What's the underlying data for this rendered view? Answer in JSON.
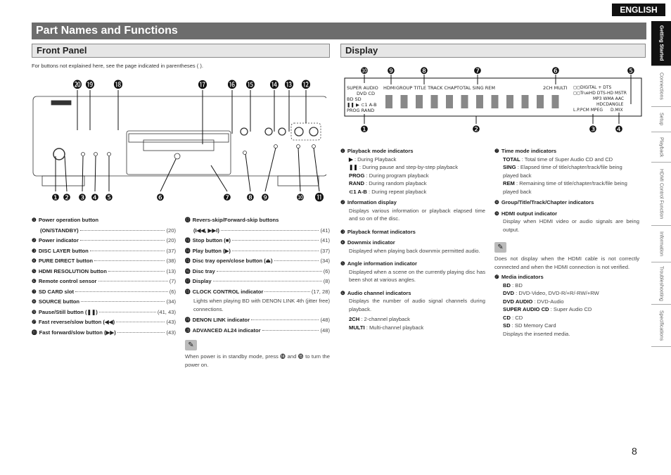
{
  "language": "ENGLISH",
  "title": "Part Names and Functions",
  "front_panel": {
    "heading": "Front Panel",
    "note": "For buttons not explained here, see the page indicated in parentheses ( ).",
    "brand": "DENON",
    "items_left": [
      {
        "num": "❶",
        "label": "Power operation button",
        "label2": "(ON/STANDBY)",
        "ref": "(20)"
      },
      {
        "num": "❷",
        "label": "Power indicator",
        "ref": "(20)"
      },
      {
        "num": "❸",
        "label": "DISC LAYER button",
        "ref": "(37)"
      },
      {
        "num": "❹",
        "label": "PURE DIRECT button",
        "ref": "(38)"
      },
      {
        "num": "❺",
        "label": "HDMI RESOLUTION button",
        "ref": "(13)"
      },
      {
        "num": "❻",
        "label": "Remote control sensor",
        "ref": "(7)"
      },
      {
        "num": "❼",
        "label": "SD CARD slot",
        "ref": "(6)"
      },
      {
        "num": "❽",
        "label": "SOURCE button",
        "ref": "(34)"
      },
      {
        "num": "❾",
        "label": "Pause/Still button (❚❚)",
        "ref": "(41, 43)"
      },
      {
        "num": "❿",
        "label": "Fast reverse/slow button (◀◀)",
        "ref": "(43)"
      },
      {
        "num": "⓫",
        "label": "Fast forward/slow button (▶▶)",
        "ref": "(43)"
      }
    ],
    "items_right": [
      {
        "num": "⓬",
        "label": "Revers-skip/Forward-skip buttons",
        "label2": "(I◀◀, ▶▶I)",
        "ref": "(41)"
      },
      {
        "num": "⓭",
        "label": "Stop button (■)",
        "ref": "(41)"
      },
      {
        "num": "⓮",
        "label": "Play button (▶)",
        "ref": "(37)"
      },
      {
        "num": "⓯",
        "label": "Disc tray open/close button (⏏)",
        "ref": "(34)"
      },
      {
        "num": "⓰",
        "label": "Disc tray",
        "ref": "(6)"
      },
      {
        "num": "⓱",
        "label": "Display",
        "ref": "(8)"
      },
      {
        "num": "⓲",
        "label": "CLOCK CONTROL indicator",
        "ref": "(17, 28)",
        "desc": "Lights when playing BD with DENON LINK 4th (jitter free) connections."
      },
      {
        "num": "⓳",
        "label": "DENON LINK indicator",
        "ref": "(48)"
      },
      {
        "num": "⓴",
        "label": "ADVANCED AL24 indicator",
        "ref": "(48)"
      }
    ],
    "memo": "When power is in standby mode, press ⓮ and ⓯ to turn the power on."
  },
  "display": {
    "heading": "Display",
    "lcd": {
      "super_audio": "SUPER AUDIO",
      "dvd_cd": "DVD   CD",
      "bd_sd": "BD SD",
      "play": "❚❚ ▶ ⊂1 A-B",
      "prog_rand": "PROG  RAND",
      "hdmi": "HDMI",
      "gttc": "GROUP  TITLE  TRACK  CHAP",
      "time": "TOTAL  SING  REM",
      "ch": "2CH  MULTI",
      "fmt1": "◻◻DIGITAL + DTS",
      "fmt2": "◻◻TrueHD DTS-HD MSTR",
      "fmt3": "MP3 WMA AAC",
      "fmt4": "HDCD",
      "angle": "ANGLE",
      "fmt5": "L.P.PCM MPEG",
      "dmix": "D.MIX"
    },
    "items_left": [
      {
        "num": "❶",
        "label": "Playback mode indicators",
        "subs": [
          {
            "k": "▶",
            "v": " : During Playback"
          },
          {
            "k": "❚❚",
            "v": " : During pause and step-by-step playback"
          },
          {
            "k": "PROG",
            "v": " : During program playback"
          },
          {
            "k": "RAND",
            "v": " : During random playback"
          },
          {
            "k": "⊂1 A-B",
            "v": " : During repeat playback"
          }
        ]
      },
      {
        "num": "❷",
        "label": "Information display",
        "desc": "Displays various information or playback elapsed time and so on of the disc."
      },
      {
        "num": "❸",
        "label": "Playback format indicators"
      },
      {
        "num": "❹",
        "label": "Downmix indicator",
        "desc": "Displayed when playing back downmix permitted audio."
      },
      {
        "num": "❺",
        "label": "Angle information indicator",
        "desc": "Displayed when a scene on the currently playing disc has been shot at various angles."
      },
      {
        "num": "❻",
        "label": "Audio channel indicators",
        "desc": "Displays the number of audio signal channels during playback.",
        "subs": [
          {
            "k": "2CH",
            "v": " : 2-channel playback"
          },
          {
            "k": "MULTI",
            "v": " : Multi-channel playback"
          }
        ]
      }
    ],
    "items_right": [
      {
        "num": "❼",
        "label": "Time mode indicators",
        "subs": [
          {
            "k": "TOTAL",
            "v": " : Total time of Super Audio CD and CD"
          },
          {
            "k": "SING",
            "v": " : Elapsed time of title/chapter/track/file being played back"
          },
          {
            "k": "REM",
            "v": " : Remaining time of title/chapter/track/file being played back"
          }
        ]
      },
      {
        "num": "❽",
        "label": "Group/Title/Track/Chapter indicators"
      },
      {
        "num": "❾",
        "label": "HDMI output indicator",
        "desc": "Display when HDMI video or audio signals are being output."
      }
    ],
    "memo": "Does not display when the HDMI cable is not correctly connected and when the HDMI connection is not verified.",
    "media": {
      "num": "❿",
      "label": "Media indicators",
      "subs": [
        {
          "k": "BD",
          "v": " : BD"
        },
        {
          "k": "DVD",
          "v": " : DVD-Video, DVD-R/+R/-RW/+RW"
        },
        {
          "k": "DVD AUDIO",
          "v": " : DVD-Audio"
        },
        {
          "k": "SUPER AUDIO CD",
          "v": " : Super Audio CD"
        },
        {
          "k": "CD",
          "v": " : CD"
        },
        {
          "k": "SD",
          "v": " : SD Memory Card"
        }
      ],
      "desc": "Displays the inserted media."
    }
  },
  "side_tabs": [
    "Getting Started",
    "Connections",
    "Setup",
    "Playback",
    "HDMI Control Function",
    "Information",
    "Troubleshooting",
    "Specifications"
  ],
  "page_number": "8"
}
